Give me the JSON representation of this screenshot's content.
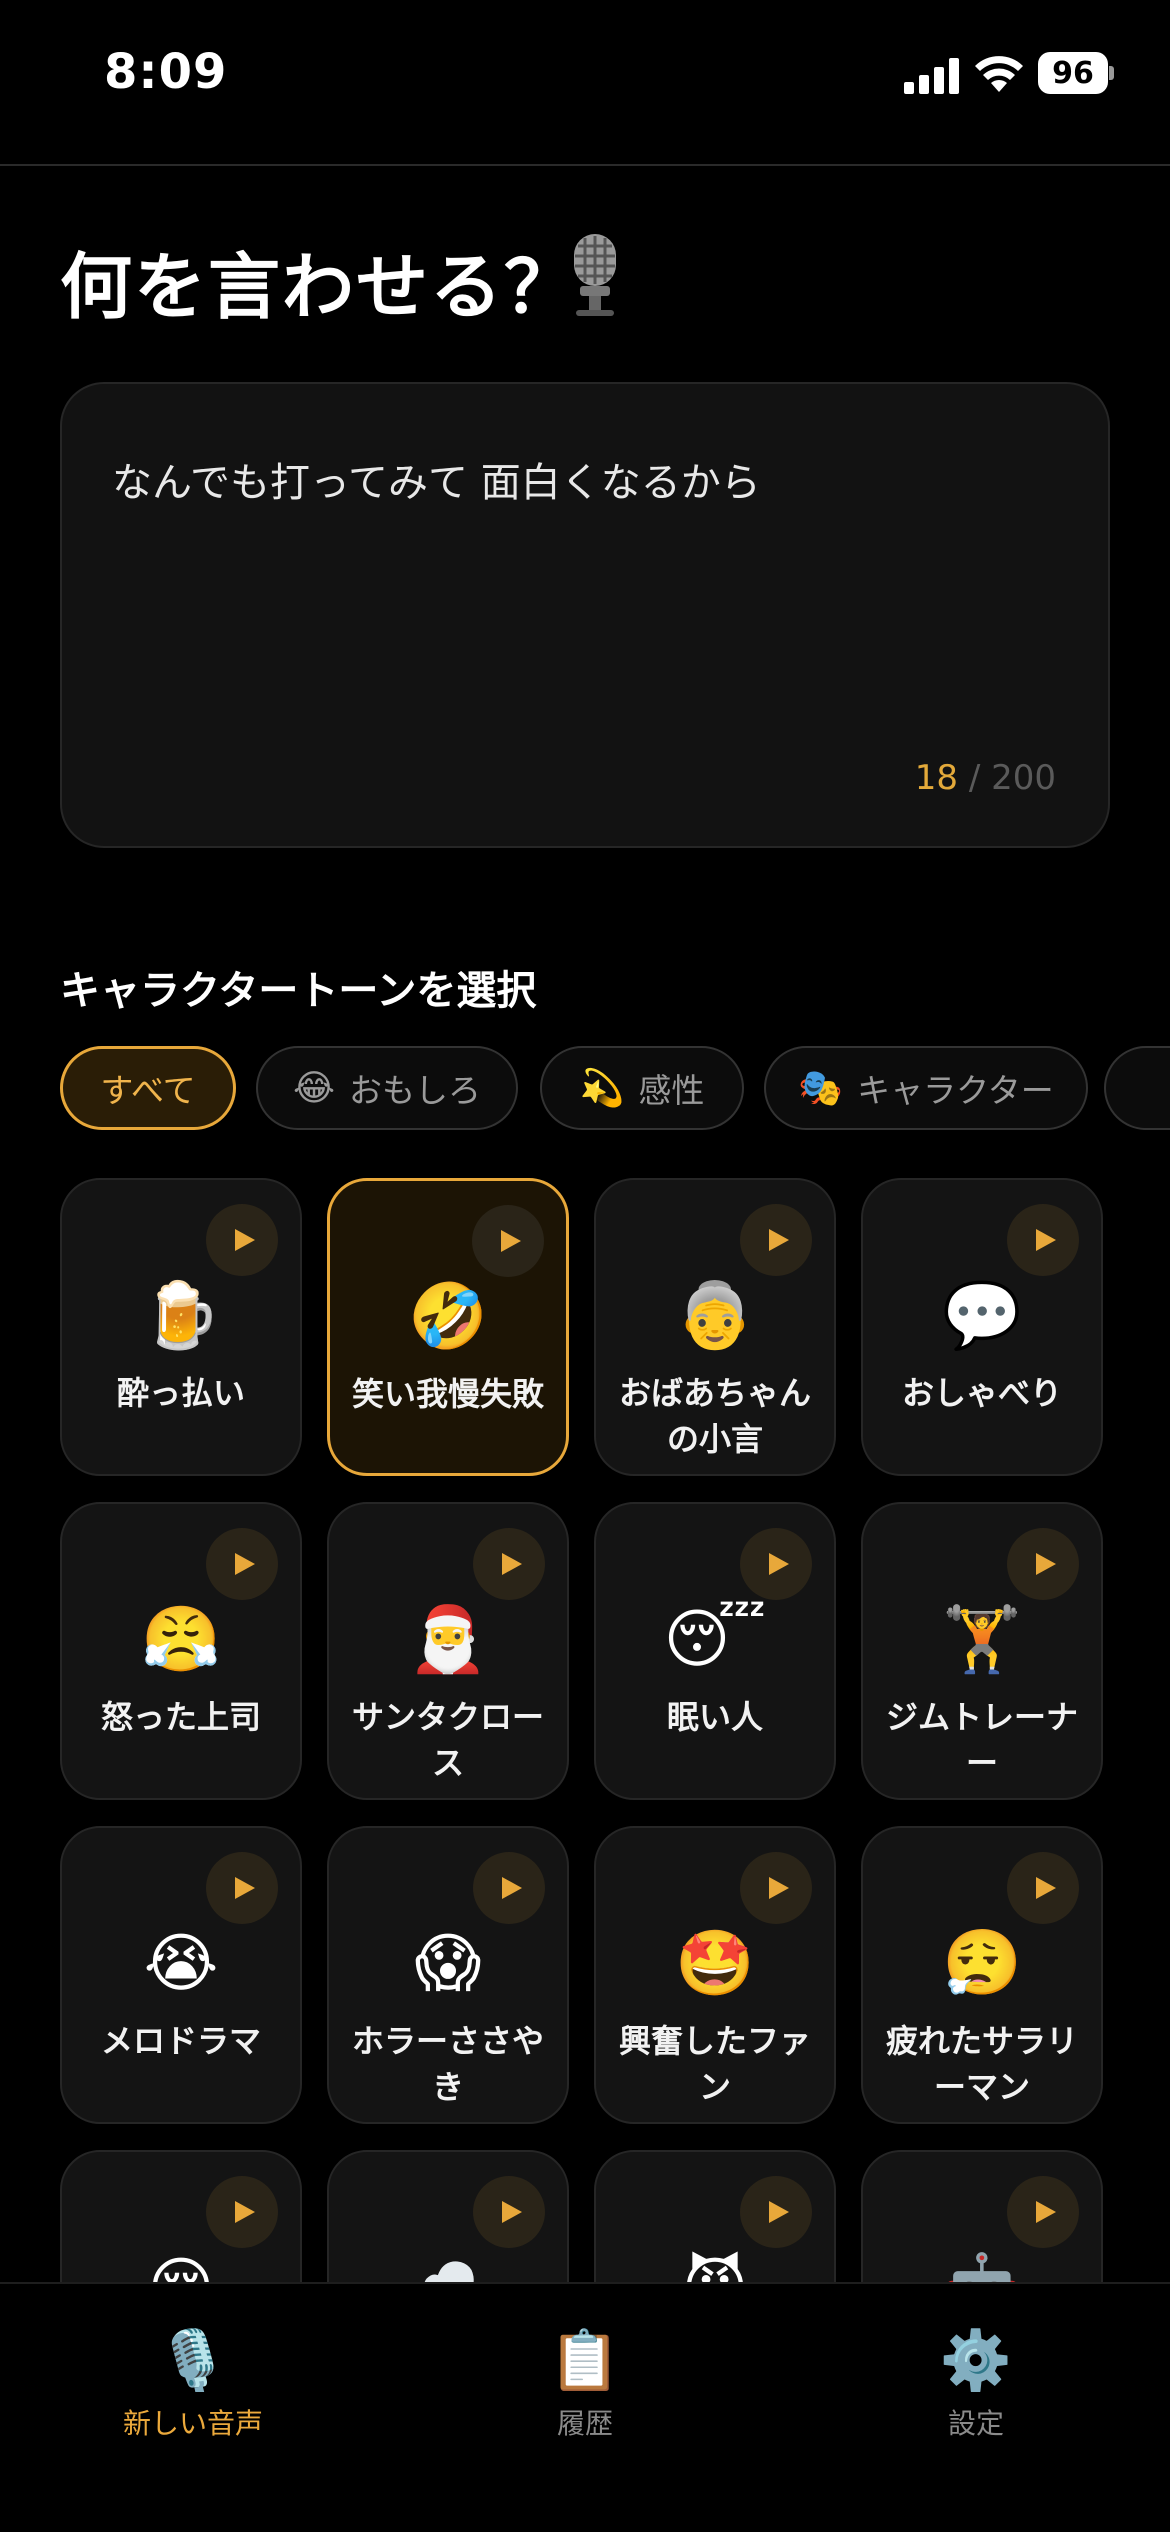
{
  "status_bar": {
    "time": "8:09",
    "battery": "96"
  },
  "title": "何を言わせる？",
  "input": {
    "text": "なんでも打ってみて 面白くなるから",
    "count": "18",
    "max": "/ 200"
  },
  "section_title": "キャラクタートーンを選択",
  "filters": [
    {
      "emoji": "",
      "label": "すべて",
      "active": true
    },
    {
      "emoji": "😂",
      "label": "おもしろ",
      "active": false
    },
    {
      "emoji": "💫",
      "label": "感性",
      "active": false
    },
    {
      "emoji": "🎭",
      "label": "キャラクター",
      "active": false
    }
  ],
  "cards": [
    {
      "emoji": "🍺",
      "label": "酔っ払い",
      "selected": false
    },
    {
      "emoji": "🤣",
      "label": "笑い我慢失敗",
      "selected": true
    },
    {
      "emoji": "👵",
      "label": "おばあちゃんの小言",
      "selected": false
    },
    {
      "emoji": "💬",
      "label": "おしゃべり",
      "selected": false
    },
    {
      "emoji": "😤",
      "label": "怒った上司",
      "selected": false
    },
    {
      "emoji": "🎅",
      "label": "サンタクロース",
      "selected": false
    },
    {
      "emoji": "😴",
      "label": "眠い人",
      "selected": false
    },
    {
      "emoji": "🏋️",
      "label": "ジムトレーナー",
      "selected": false
    },
    {
      "emoji": "😭",
      "label": "メロドラマ",
      "selected": false
    },
    {
      "emoji": "😱",
      "label": "ホラーささやき",
      "selected": false
    },
    {
      "emoji": "🤩",
      "label": "興奮したファン",
      "selected": false
    },
    {
      "emoji": "😮‍💨",
      "label": "疲れたサラリーマン",
      "selected": false
    },
    {
      "emoji": "😌",
      "label": "",
      "selected": false
    },
    {
      "emoji": "☁️",
      "label": "",
      "selected": false
    },
    {
      "emoji": "😈",
      "label": "",
      "selected": false
    },
    {
      "emoji": "🤖",
      "label": "",
      "selected": false
    }
  ],
  "tabs": [
    {
      "icon": "🎙️",
      "label": "新しい音声",
      "active": true
    },
    {
      "icon": "📋",
      "label": "履歴",
      "active": false
    },
    {
      "icon": "⚙️",
      "label": "設定",
      "active": false
    }
  ],
  "colors": {
    "accent": "#e8a83a",
    "background": "#000000",
    "card": "#141414"
  }
}
